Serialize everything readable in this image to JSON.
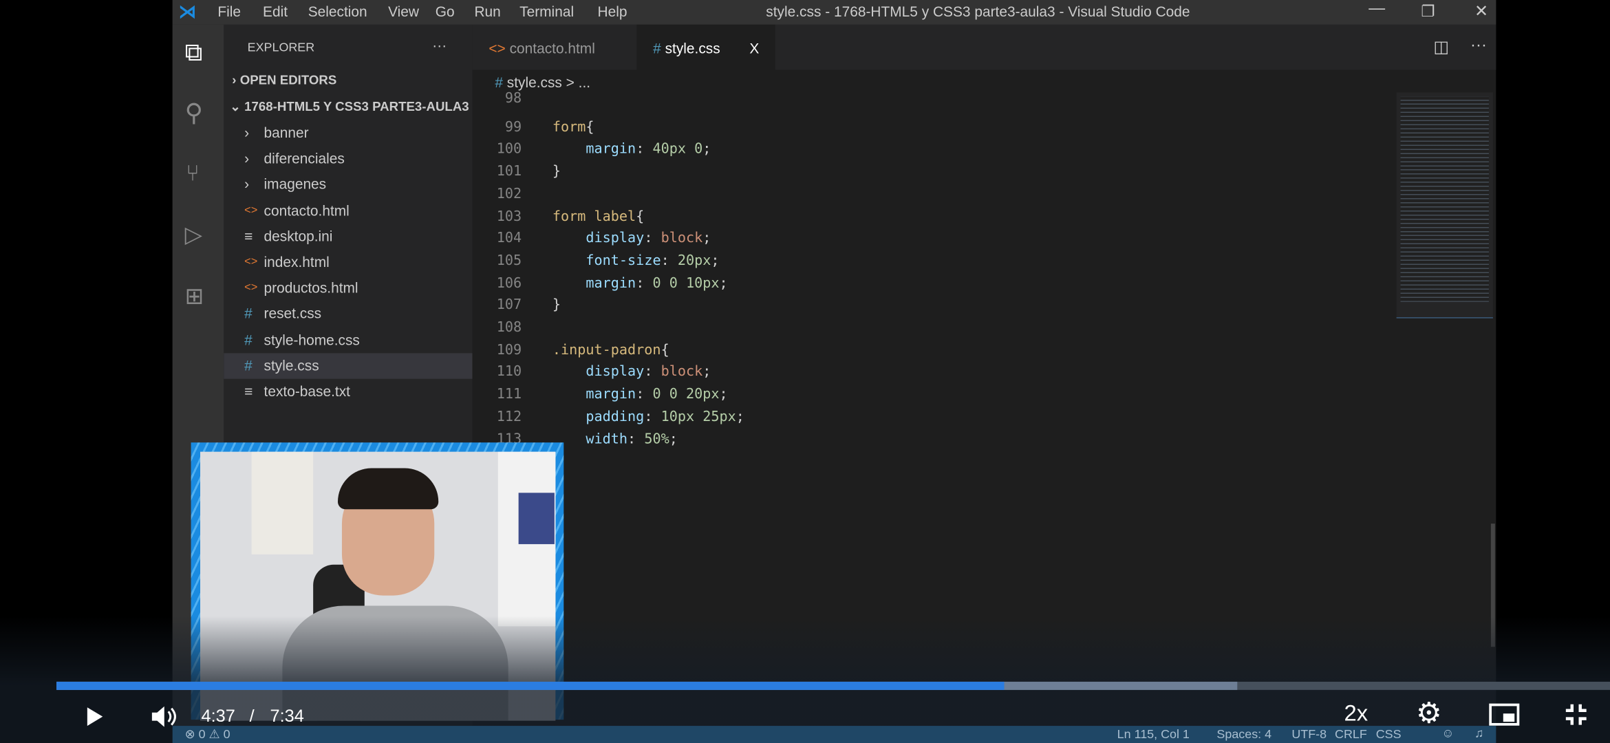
{
  "window": {
    "title": "style.css - 1768-HTML5 y CSS3 parte3-aula3 - Visual Studio Code",
    "menu": [
      "File",
      "Edit",
      "Selection",
      "View",
      "Go",
      "Run",
      "Terminal",
      "Help"
    ]
  },
  "sidebar": {
    "header": "EXPLORER",
    "more": "···",
    "open_editors": "OPEN EDITORS",
    "project": "1768-HTML5 Y CSS3 PARTE3-AULA3",
    "items": [
      {
        "label": "banner",
        "type": "folder"
      },
      {
        "label": "diferenciales",
        "type": "folder"
      },
      {
        "label": "imagenes",
        "type": "folder"
      },
      {
        "label": "contacto.html",
        "type": "html"
      },
      {
        "label": "desktop.ini",
        "type": "text"
      },
      {
        "label": "index.html",
        "type": "html"
      },
      {
        "label": "productos.html",
        "type": "html"
      },
      {
        "label": "reset.css",
        "type": "css"
      },
      {
        "label": "style-home.css",
        "type": "css"
      },
      {
        "label": "style.css",
        "type": "css",
        "selected": true
      },
      {
        "label": "texto-base.txt",
        "type": "text"
      }
    ]
  },
  "tabs": [
    {
      "label": "contacto.html",
      "icon": "<>"
    },
    {
      "label": "style.css",
      "icon": "#",
      "active": true,
      "close": "X"
    }
  ],
  "breadcrumb": {
    "icon": "#",
    "file": "style.css",
    "rest": "> ..."
  },
  "editor": {
    "lines": [
      {
        "n": "98",
        "t": []
      },
      {
        "n": "99",
        "t": [
          [
            "sel-c",
            "form"
          ],
          [
            "pun",
            "{"
          ]
        ]
      },
      {
        "n": "100",
        "t": [
          [
            "pun",
            "    "
          ],
          [
            "prop",
            "margin"
          ],
          [
            "pun",
            ": "
          ],
          [
            "val",
            "40px 0"
          ],
          [
            "pun",
            ";"
          ]
        ]
      },
      {
        "n": "101",
        "t": [
          [
            "pun",
            "}"
          ]
        ]
      },
      {
        "n": "102",
        "t": []
      },
      {
        "n": "103",
        "t": [
          [
            "sel-c",
            "form label"
          ],
          [
            "pun",
            "{"
          ]
        ]
      },
      {
        "n": "104",
        "t": [
          [
            "pun",
            "    "
          ],
          [
            "prop",
            "display"
          ],
          [
            "pun",
            ": "
          ],
          [
            "kw",
            "block"
          ],
          [
            "pun",
            ";"
          ]
        ]
      },
      {
        "n": "105",
        "t": [
          [
            "pun",
            "    "
          ],
          [
            "prop",
            "font-size"
          ],
          [
            "pun",
            ": "
          ],
          [
            "val",
            "20px"
          ],
          [
            "pun",
            ";"
          ]
        ]
      },
      {
        "n": "106",
        "t": [
          [
            "pun",
            "    "
          ],
          [
            "prop",
            "margin"
          ],
          [
            "pun",
            ": "
          ],
          [
            "val",
            "0 0 10px"
          ],
          [
            "pun",
            ";"
          ]
        ]
      },
      {
        "n": "107",
        "t": [
          [
            "pun",
            "}"
          ]
        ]
      },
      {
        "n": "108",
        "t": []
      },
      {
        "n": "109",
        "t": [
          [
            "sel-c",
            ".input-padron"
          ],
          [
            "pun",
            "{"
          ]
        ]
      },
      {
        "n": "110",
        "t": [
          [
            "pun",
            "    "
          ],
          [
            "prop",
            "display"
          ],
          [
            "pun",
            ": "
          ],
          [
            "kw",
            "block"
          ],
          [
            "pun",
            ";"
          ]
        ]
      },
      {
        "n": "111",
        "t": [
          [
            "pun",
            "    "
          ],
          [
            "prop",
            "margin"
          ],
          [
            "pun",
            ": "
          ],
          [
            "val",
            "0 0 20px"
          ],
          [
            "pun",
            ";"
          ]
        ]
      },
      {
        "n": "112",
        "t": [
          [
            "pun",
            "    "
          ],
          [
            "prop",
            "padding"
          ],
          [
            "pun",
            ": "
          ],
          [
            "val",
            "10px 25px"
          ],
          [
            "pun",
            ";"
          ]
        ]
      },
      {
        "n": "113",
        "t": [
          [
            "pun",
            "    "
          ],
          [
            "prop",
            "width"
          ],
          [
            "pun",
            ": "
          ],
          [
            "val",
            "50%"
          ],
          [
            "pun",
            ";"
          ]
        ]
      }
    ]
  },
  "statusbar": {
    "errors": "0",
    "warnings": "0",
    "position": "Ln 115, Col 1",
    "spaces": "Spaces: 4",
    "encoding": "UTF-8",
    "eol": "CRLF",
    "language": "CSS"
  },
  "player": {
    "current_time": "4:37",
    "separator": "/",
    "duration": "7:34",
    "speed": "2x",
    "played_fraction": 0.61,
    "buffered_fraction": 0.76,
    "accent": "#2b7de1"
  }
}
